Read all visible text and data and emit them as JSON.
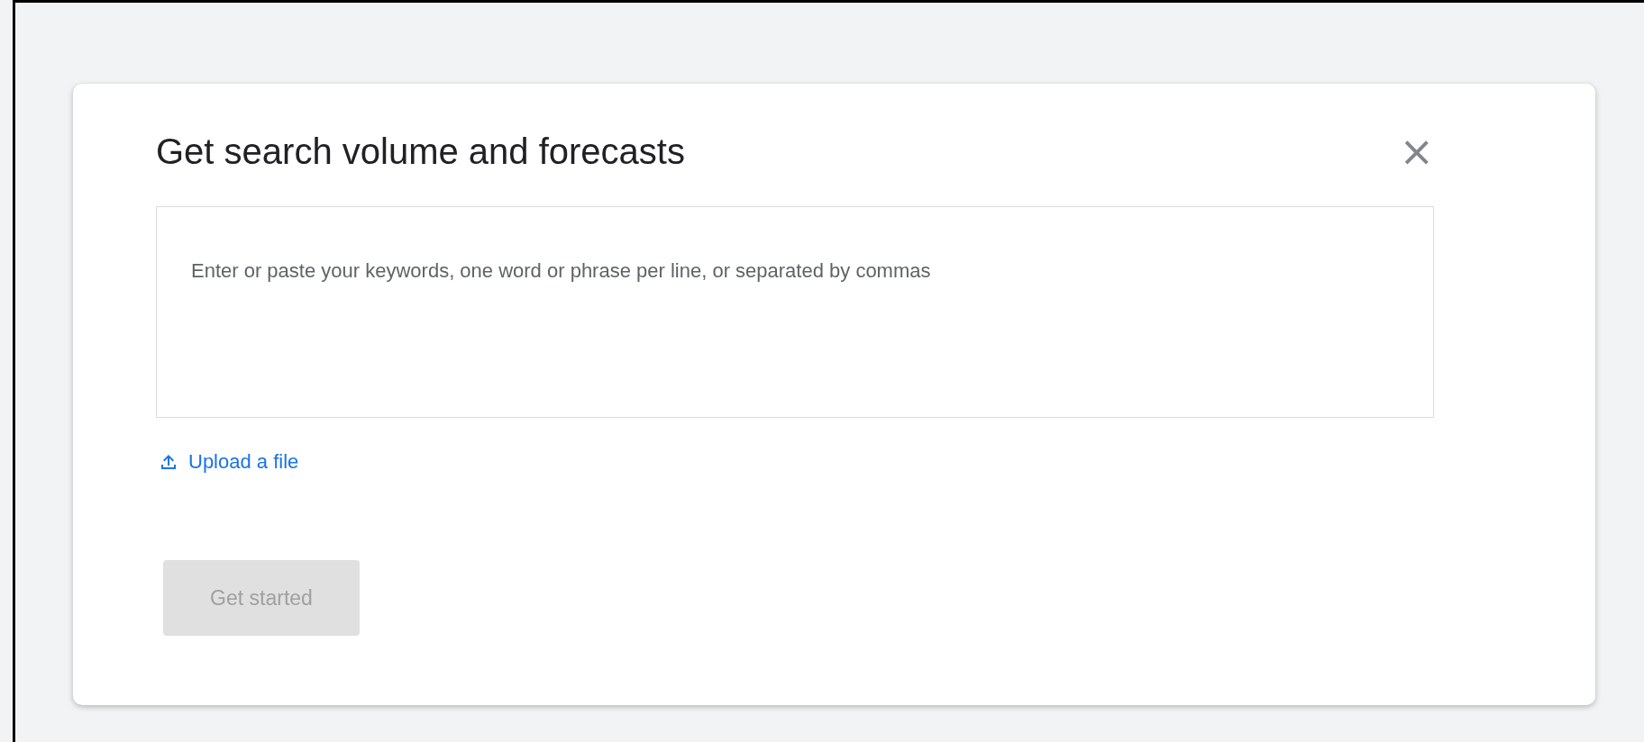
{
  "dialog": {
    "title": "Get search volume and forecasts",
    "close_icon": "×",
    "keywords_field": {
      "placeholder": "Enter or paste your keywords, one word or phrase per line, or separated by commas"
    },
    "upload_link": "Upload a file",
    "primary_button": {
      "label": "Get started",
      "disabled": true
    }
  }
}
